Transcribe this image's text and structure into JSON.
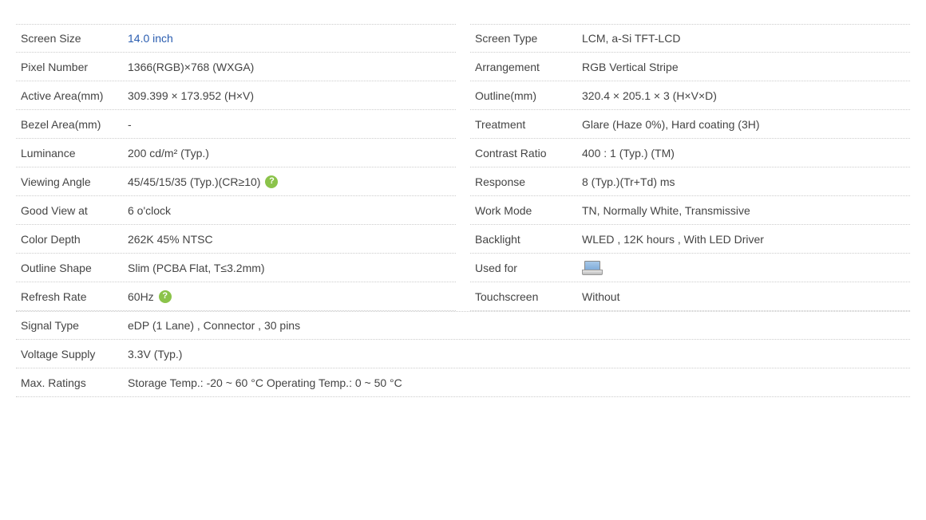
{
  "left": [
    {
      "label": "Screen Size",
      "value": "14.0 inch",
      "link": true
    },
    {
      "label": "Pixel Number",
      "value": "1366(RGB)×768   (WXGA)"
    },
    {
      "label": "Active Area(mm)",
      "value": "309.399 × 173.952 (H×V)"
    },
    {
      "label": "Bezel Area(mm)",
      "value": "-"
    },
    {
      "label": "Luminance",
      "value": "200 cd/m² (Typ.)"
    },
    {
      "label": "Viewing Angle",
      "value": "45/45/15/35 (Typ.)(CR≥10)",
      "help": true
    },
    {
      "label": "Good View at",
      "value": "6 o'clock"
    },
    {
      "label": "Color Depth",
      "value": "262K   45% NTSC"
    },
    {
      "label": "Outline Shape",
      "value": "Slim (PCBA Flat, T≤3.2mm)"
    },
    {
      "label": "Refresh Rate",
      "value": "60Hz",
      "help": true
    }
  ],
  "right": [
    {
      "label": "Screen Type",
      "value": "LCM,   a-Si TFT-LCD"
    },
    {
      "label": "Arrangement",
      "value": "RGB Vertical Stripe"
    },
    {
      "label": "Outline(mm)",
      "value": "320.4 × 205.1 × 3 (H×V×D)"
    },
    {
      "label": "Treatment",
      "value": "Glare (Haze 0%), Hard coating (3H)"
    },
    {
      "label": "Contrast Ratio",
      "value": "400 : 1 (Typ.) (TM)"
    },
    {
      "label": "Response",
      "value": "8 (Typ.)(Tr+Td) ms"
    },
    {
      "label": "Work Mode",
      "value": "TN, Normally White, Transmissive"
    },
    {
      "label": "Backlight",
      "value": "WLED , 12K hours , With LED Driver"
    },
    {
      "label": "Used for",
      "value": "",
      "icon": "laptop"
    },
    {
      "label": "Touchscreen",
      "value": "Without"
    }
  ],
  "bottom": [
    {
      "label": "Signal Type",
      "value": "eDP (1 Lane) , Connector , 30 pins"
    },
    {
      "label": "Voltage Supply",
      "value": "3.3V (Typ.)"
    },
    {
      "label": "Max. Ratings",
      "value": "Storage Temp.: -20 ~ 60 °C    Operating Temp.: 0 ~ 50 °C"
    }
  ],
  "helpGlyph": "?"
}
